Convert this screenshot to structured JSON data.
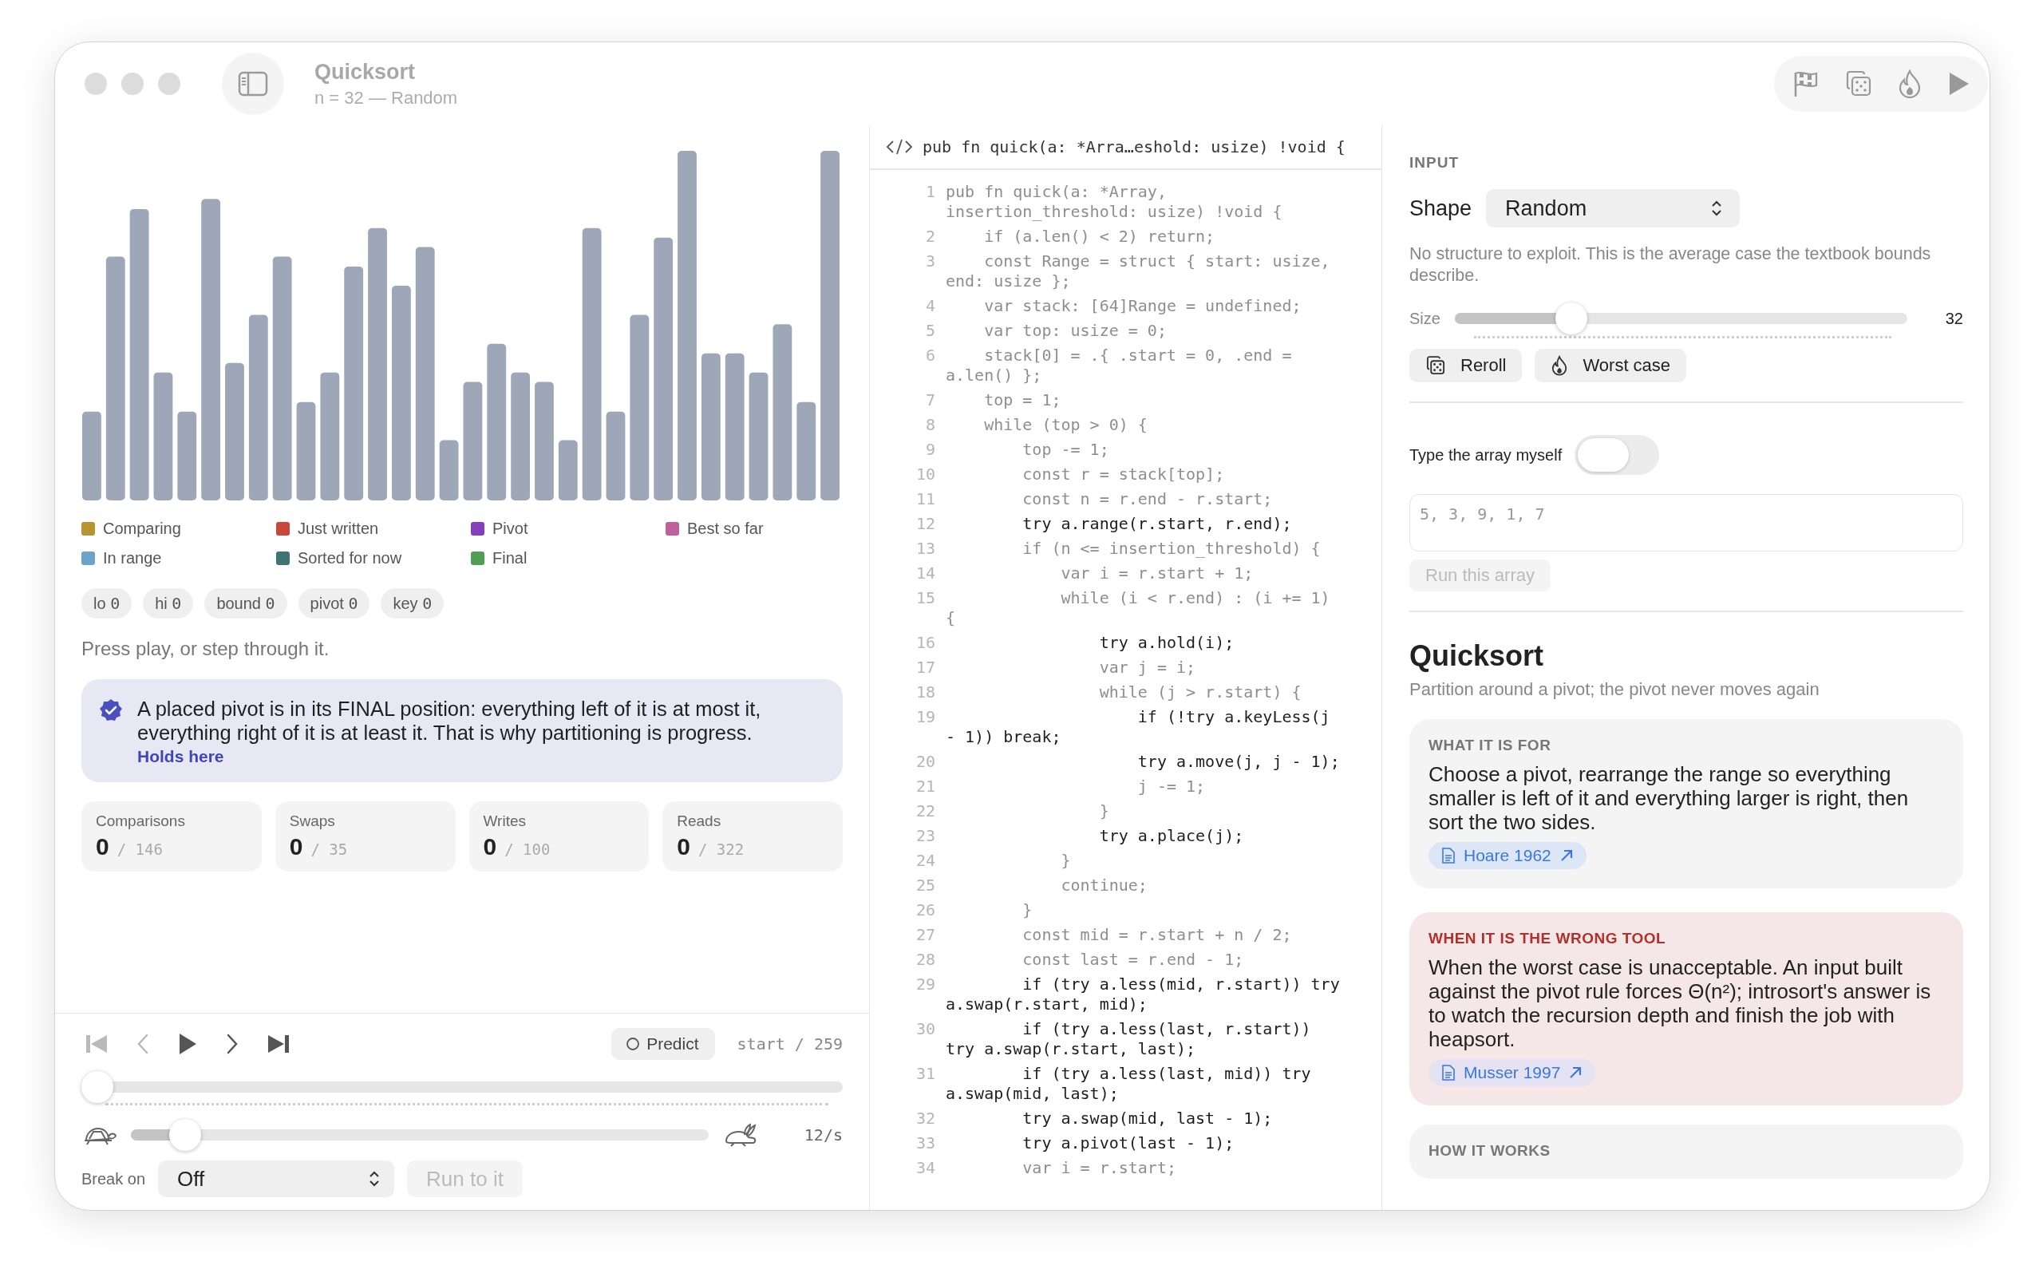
{
  "window": {
    "title": "Quicksort",
    "subtitle": "n = 32 — Random"
  },
  "visualizer": {
    "legend": [
      {
        "label": "Comparing",
        "color": "#b5952f"
      },
      {
        "label": "Just written",
        "color": "#c8463a"
      },
      {
        "label": "Pivot",
        "color": "#8340b8"
      },
      {
        "label": "Best so far",
        "color": "#c0609a"
      },
      {
        "label": "In range",
        "color": "#6aa5c8"
      },
      {
        "label": "Sorted for now",
        "color": "#3e7475"
      },
      {
        "label": "Final",
        "color": "#4f9f55"
      }
    ],
    "registers": [
      {
        "name": "lo",
        "value": "0"
      },
      {
        "name": "hi",
        "value": "0"
      },
      {
        "name": "bound",
        "value": "0"
      },
      {
        "name": "pivot",
        "value": "0"
      },
      {
        "name": "key",
        "value": "0"
      }
    ],
    "status": "Press play, or step through it.",
    "invariant": {
      "text": "A placed pivot is in its FINAL position: everything left of it is at most it, everything right of it is at least it. That is why partitioning is progress.",
      "link": "Holds here"
    },
    "counters": [
      {
        "label": "Comparisons",
        "value": "0",
        "total": "/ 146"
      },
      {
        "label": "Swaps",
        "value": "0",
        "total": "/ 35"
      },
      {
        "label": "Writes",
        "value": "0",
        "total": "/ 100"
      },
      {
        "label": "Reads",
        "value": "0",
        "total": "/ 322"
      }
    ]
  },
  "playback": {
    "transport": [
      {
        "kind": "first",
        "disabled": true
      },
      {
        "kind": "previous",
        "disabled": true
      },
      {
        "kind": "play",
        "disabled": false
      },
      {
        "kind": "next",
        "disabled": false
      },
      {
        "kind": "last",
        "disabled": false
      }
    ],
    "predict": "Predict",
    "position": "start / 259",
    "progress": {
      "level": 0
    },
    "speed": {
      "level": 0.07,
      "reading": "12/s"
    },
    "break_on": {
      "label": "Break on",
      "value": "Off"
    },
    "run_to": {
      "label": "Run to it",
      "disabled": true
    }
  },
  "code": {
    "signature": "pub fn quick(a: *Arra…eshold: usize) !void {",
    "lines": [
      {
        "number": "1",
        "text": "pub fn quick(a: *Array, insertion_threshold: usize) !void {",
        "highlighted": false
      },
      {
        "number": "2",
        "text": "    if (a.len() < 2) return;",
        "highlighted": false
      },
      {
        "number": "3",
        "text": "    const Range = struct { start: usize, end: usize };",
        "highlighted": false
      },
      {
        "number": "4",
        "text": "    var stack: [64]Range = undefined;",
        "highlighted": false
      },
      {
        "number": "5",
        "text": "    var top: usize = 0;",
        "highlighted": false
      },
      {
        "number": "6",
        "text": "    stack[0] = .{ .start = 0, .end = a.len() };",
        "highlighted": false
      },
      {
        "number": "7",
        "text": "    top = 1;",
        "highlighted": false
      },
      {
        "number": "8",
        "text": "    while (top > 0) {",
        "highlighted": false
      },
      {
        "number": "9",
        "text": "        top -= 1;",
        "highlighted": false
      },
      {
        "number": "10",
        "text": "        const r = stack[top];",
        "highlighted": false
      },
      {
        "number": "11",
        "text": "        const n = r.end - r.start;",
        "highlighted": false
      },
      {
        "number": "12",
        "text": "        try a.range(r.start, r.end);",
        "highlighted": true
      },
      {
        "number": "13",
        "text": "        if (n <= insertion_threshold) {",
        "highlighted": false
      },
      {
        "number": "14",
        "text": "            var i = r.start + 1;",
        "highlighted": false
      },
      {
        "number": "15",
        "text": "            while (i < r.end) : (i += 1) {",
        "highlighted": false
      },
      {
        "number": "16",
        "text": "                try a.hold(i);",
        "highlighted": true
      },
      {
        "number": "17",
        "text": "                var j = i;",
        "highlighted": false
      },
      {
        "number": "18",
        "text": "                while (j > r.start) {",
        "highlighted": false
      },
      {
        "number": "19",
        "text": "                    if (!try a.keyLess(j - 1)) break;",
        "highlighted": true
      },
      {
        "number": "20",
        "text": "                    try a.move(j, j - 1);",
        "highlighted": true
      },
      {
        "number": "21",
        "text": "                    j -= 1;",
        "highlighted": false
      },
      {
        "number": "22",
        "text": "                }",
        "highlighted": false
      },
      {
        "number": "23",
        "text": "                try a.place(j);",
        "highlighted": true
      },
      {
        "number": "24",
        "text": "            }",
        "highlighted": false
      },
      {
        "number": "25",
        "text": "            continue;",
        "highlighted": false
      },
      {
        "number": "26",
        "text": "        }",
        "highlighted": false
      },
      {
        "number": "27",
        "text": "        const mid = r.start + n / 2;",
        "highlighted": false
      },
      {
        "number": "28",
        "text": "        const last = r.end - 1;",
        "highlighted": false
      },
      {
        "number": "29",
        "text": "        if (try a.less(mid, r.start)) try a.swap(r.start, mid);",
        "highlighted": true
      },
      {
        "number": "30",
        "text": "        if (try a.less(last, r.start)) try a.swap(r.start, last);",
        "highlighted": true
      },
      {
        "number": "31",
        "text": "        if (try a.less(last, mid)) try a.swap(mid, last);",
        "highlighted": true
      },
      {
        "number": "32",
        "text": "        try a.swap(mid, last - 1);",
        "highlighted": true
      },
      {
        "number": "33",
        "text": "        try a.pivot(last - 1);",
        "highlighted": true
      },
      {
        "number": "34",
        "text": "        var i = r.start;",
        "highlighted": false
      }
    ]
  },
  "input": {
    "heading": "INPUT",
    "shape": {
      "label": "Shape",
      "value": "Random"
    },
    "description": "No structure to exploit. This is the average case the textbook bounds describe.",
    "size": {
      "label": "Size",
      "level": 0.24,
      "reading": "32"
    },
    "buttons": [
      {
        "kind": "dice",
        "label": "Reroll"
      },
      {
        "kind": "flame",
        "label": "Worst case"
      }
    ],
    "custom": {
      "label": "Type the array myself",
      "on": false
    },
    "array_field": {
      "placeholder": "5, 3, 9, 1, 7"
    },
    "run": {
      "label": "Run this array",
      "disabled": true
    }
  },
  "about": {
    "title": "Quicksort",
    "subtitle": "Partition around a pivot; the pivot never moves again",
    "cards": [
      {
        "kind": "info",
        "heading": "WHAT IT IS FOR",
        "text": "Choose a pivot, rearrange the range so everything smaller is left of it and everything larger is right, then sort the two sides.",
        "reference": "Hoare 1962"
      },
      {
        "kind": "warning",
        "heading": "WHEN IT IS THE WRONG TOOL",
        "text": "When the worst case is unacceptable. An input built against the pivot rule forces Θ(n²); introsort's answer is to watch the recursion depth and finish the job with heapsort.",
        "reference": "Musser 1997"
      },
      {
        "kind": "info",
        "heading": "HOW IT WORKS"
      }
    ]
  }
}
